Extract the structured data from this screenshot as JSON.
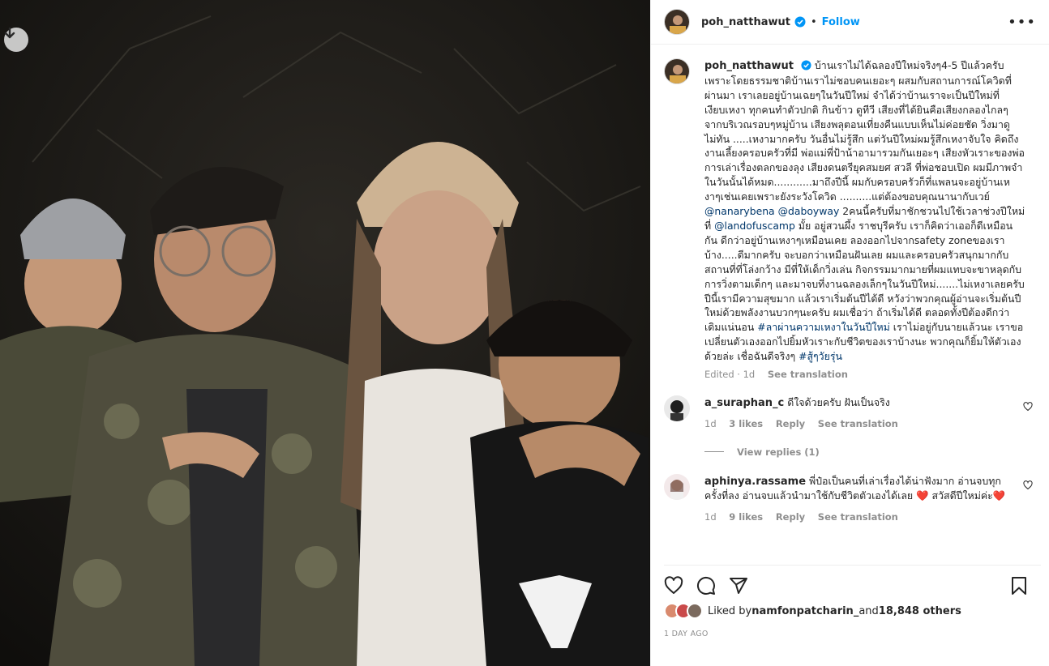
{
  "post": {
    "username": "poh_natthawut",
    "follow_label": "Follow",
    "dot": "•",
    "more_label": "•••"
  },
  "caption": {
    "username": "poh_natthawut",
    "text1": "บ้านเราไม่ได้ฉลองปีใหม่จริงๆ4-5 ปีแล้วครับ เพราะโดยธรรมชาติบ้านเราไม่ชอบคนเยอะๆ ผสมกับสถานการณ์โควิดที่ผ่านมา เราเลยอยู่บ้านเฉยๆในวันปีใหม่ จำได้ว่าบ้านเราจะเป็นปีใหม่ที่เงียบเหงา ทุกคนทำตัวปกติ กินข้าว ดูทีวี เสียงที่ได้ยินคือเสียงกลองไกลๆจากบริเวณรอบๆหมู่บ้าน เสียงพลุตอนเที่ยงคืนแบบเห็นไม่ค่อยชัด วิ่งมาดูไม่ทัน .....เหงามากครับ วันอื่นไม่รู้สึก แต่วันปีใหม่ผมรู้สึกเหงาจับใจ คิดถึงงานเลี้ยงครอบครัวที่มี พ่อแม่พี่ป้าน้าอามารวมกันเยอะๆ เสียงหัวเราะของพ่อ การเล่าเรื่องตลกของลุง เสียงดนตรียุคสมยศ สวลี ที่พ่อชอบเปิด ผมมีภาพจำในวันนั้นได้หมด............มาถึงปีนี้ ผมกับครอบครัวก็ที่แพลนจะอยู่บ้านเหงาๆเช่นเคยเพราะยังระวังโควิด ..........แต่ต้องขอบคุณนานากับเวย์ ",
    "mention1": "@nanarybena",
    "space": " ",
    "mention2": "@daboyway",
    "text2": " 2คนนี้ครับที่มาชักชวนไปใช้เวลาช่วงปีใหม่ที่ ",
    "mention3": "@landofuscamp",
    "text3": " มั้ย อยู่สวนผึ้ง ราชบุรีครับ เราก็คิดว่าเออก็ดีเหมือนกัน ดีกว่าอยู่บ้านเหงาๆเหมือนเคย ลองออกไปจากsafety zoneของเราบ้าง.....ดีมากครับ จะบอกว่าเหมือนฝันเลย ผมและครอบครัวสนุกมากกับสถานที่ที่โล่งกว้าง มีที่ให้เด็กวิ่งเล่น กิจกรรมมากมายที่ผมแทบจะขาหลุดกับการวิ่งตามเด็กๆ และมาจบที่งานฉลองเล็กๆในวันปีใหม่.......ไม่เหงาเลยครับ ปีนี้เรามีความสุขมาก แล้วเราเริ่มต้นปีได้ดี หวังว่าพวกคุณผู้อ่านจะเริ่มต้นปีใหม่ด้วยพลังงานบวกๆนะครับ ผมเชื่อว่า ถ้าเริ่มได้ดี ตลอดทั้งปีต้องดีกว่าเดิมแน่นอน ",
    "hashtag1": "#ลาผ่านความเหงาในวันปีใหม่",
    "text4": " เราไม่อยู่กับนายแล้วนะ เราขอเปลี่ยนตัวเองออกไปยิ้มหัวเราะกับชีวิตของเราบ้างนะ พวกคุณก็ยิ้มให้ตัวเองด้วยล่ะ เชื่อฉันดีจริงๆ ",
    "hashtag2": "#สู้ๆวัยรุ่น",
    "edited": "Edited · 1d",
    "see_translation": "See translation"
  },
  "comments": [
    {
      "username": "a_suraphan_c",
      "text": "ดีใจด้วยครับ ฝันเป็นจริง",
      "time": "1d",
      "likes": "3 likes",
      "reply": "Reply",
      "see_translation": "See translation"
    },
    {
      "username": "aphinya.rassame",
      "text": "พี่ป๋อเป็นคนที่เล่าเรื่องได้น่าฟังมาก อ่านจบทุกครั้งที่ลง อ่านจบแล้วนำมาใช้กับชีวิตตัวเองได้เลย",
      "heart": "❤️",
      "text2": "สวัสดีปีใหม่ค่ะ",
      "time": "1d",
      "likes": "9 likes",
      "reply": "Reply",
      "see_translation": "See translation"
    }
  ],
  "view_replies": "View replies (1)",
  "likes": {
    "prefix": "Liked by ",
    "user": "namfonpatcharin_",
    "middle": " and ",
    "count": "18,848 others"
  },
  "time_ago": "1 DAY AGO",
  "colors": {
    "link": "#00376b",
    "follow": "#0095f6",
    "verified": "#0095f6",
    "muted": "#8e8e8e",
    "heart": "#ed4956"
  },
  "icons": [
    "download-icon",
    "verified-icon",
    "more-icon",
    "heart-icon",
    "comment-icon",
    "share-icon",
    "save-icon"
  ]
}
